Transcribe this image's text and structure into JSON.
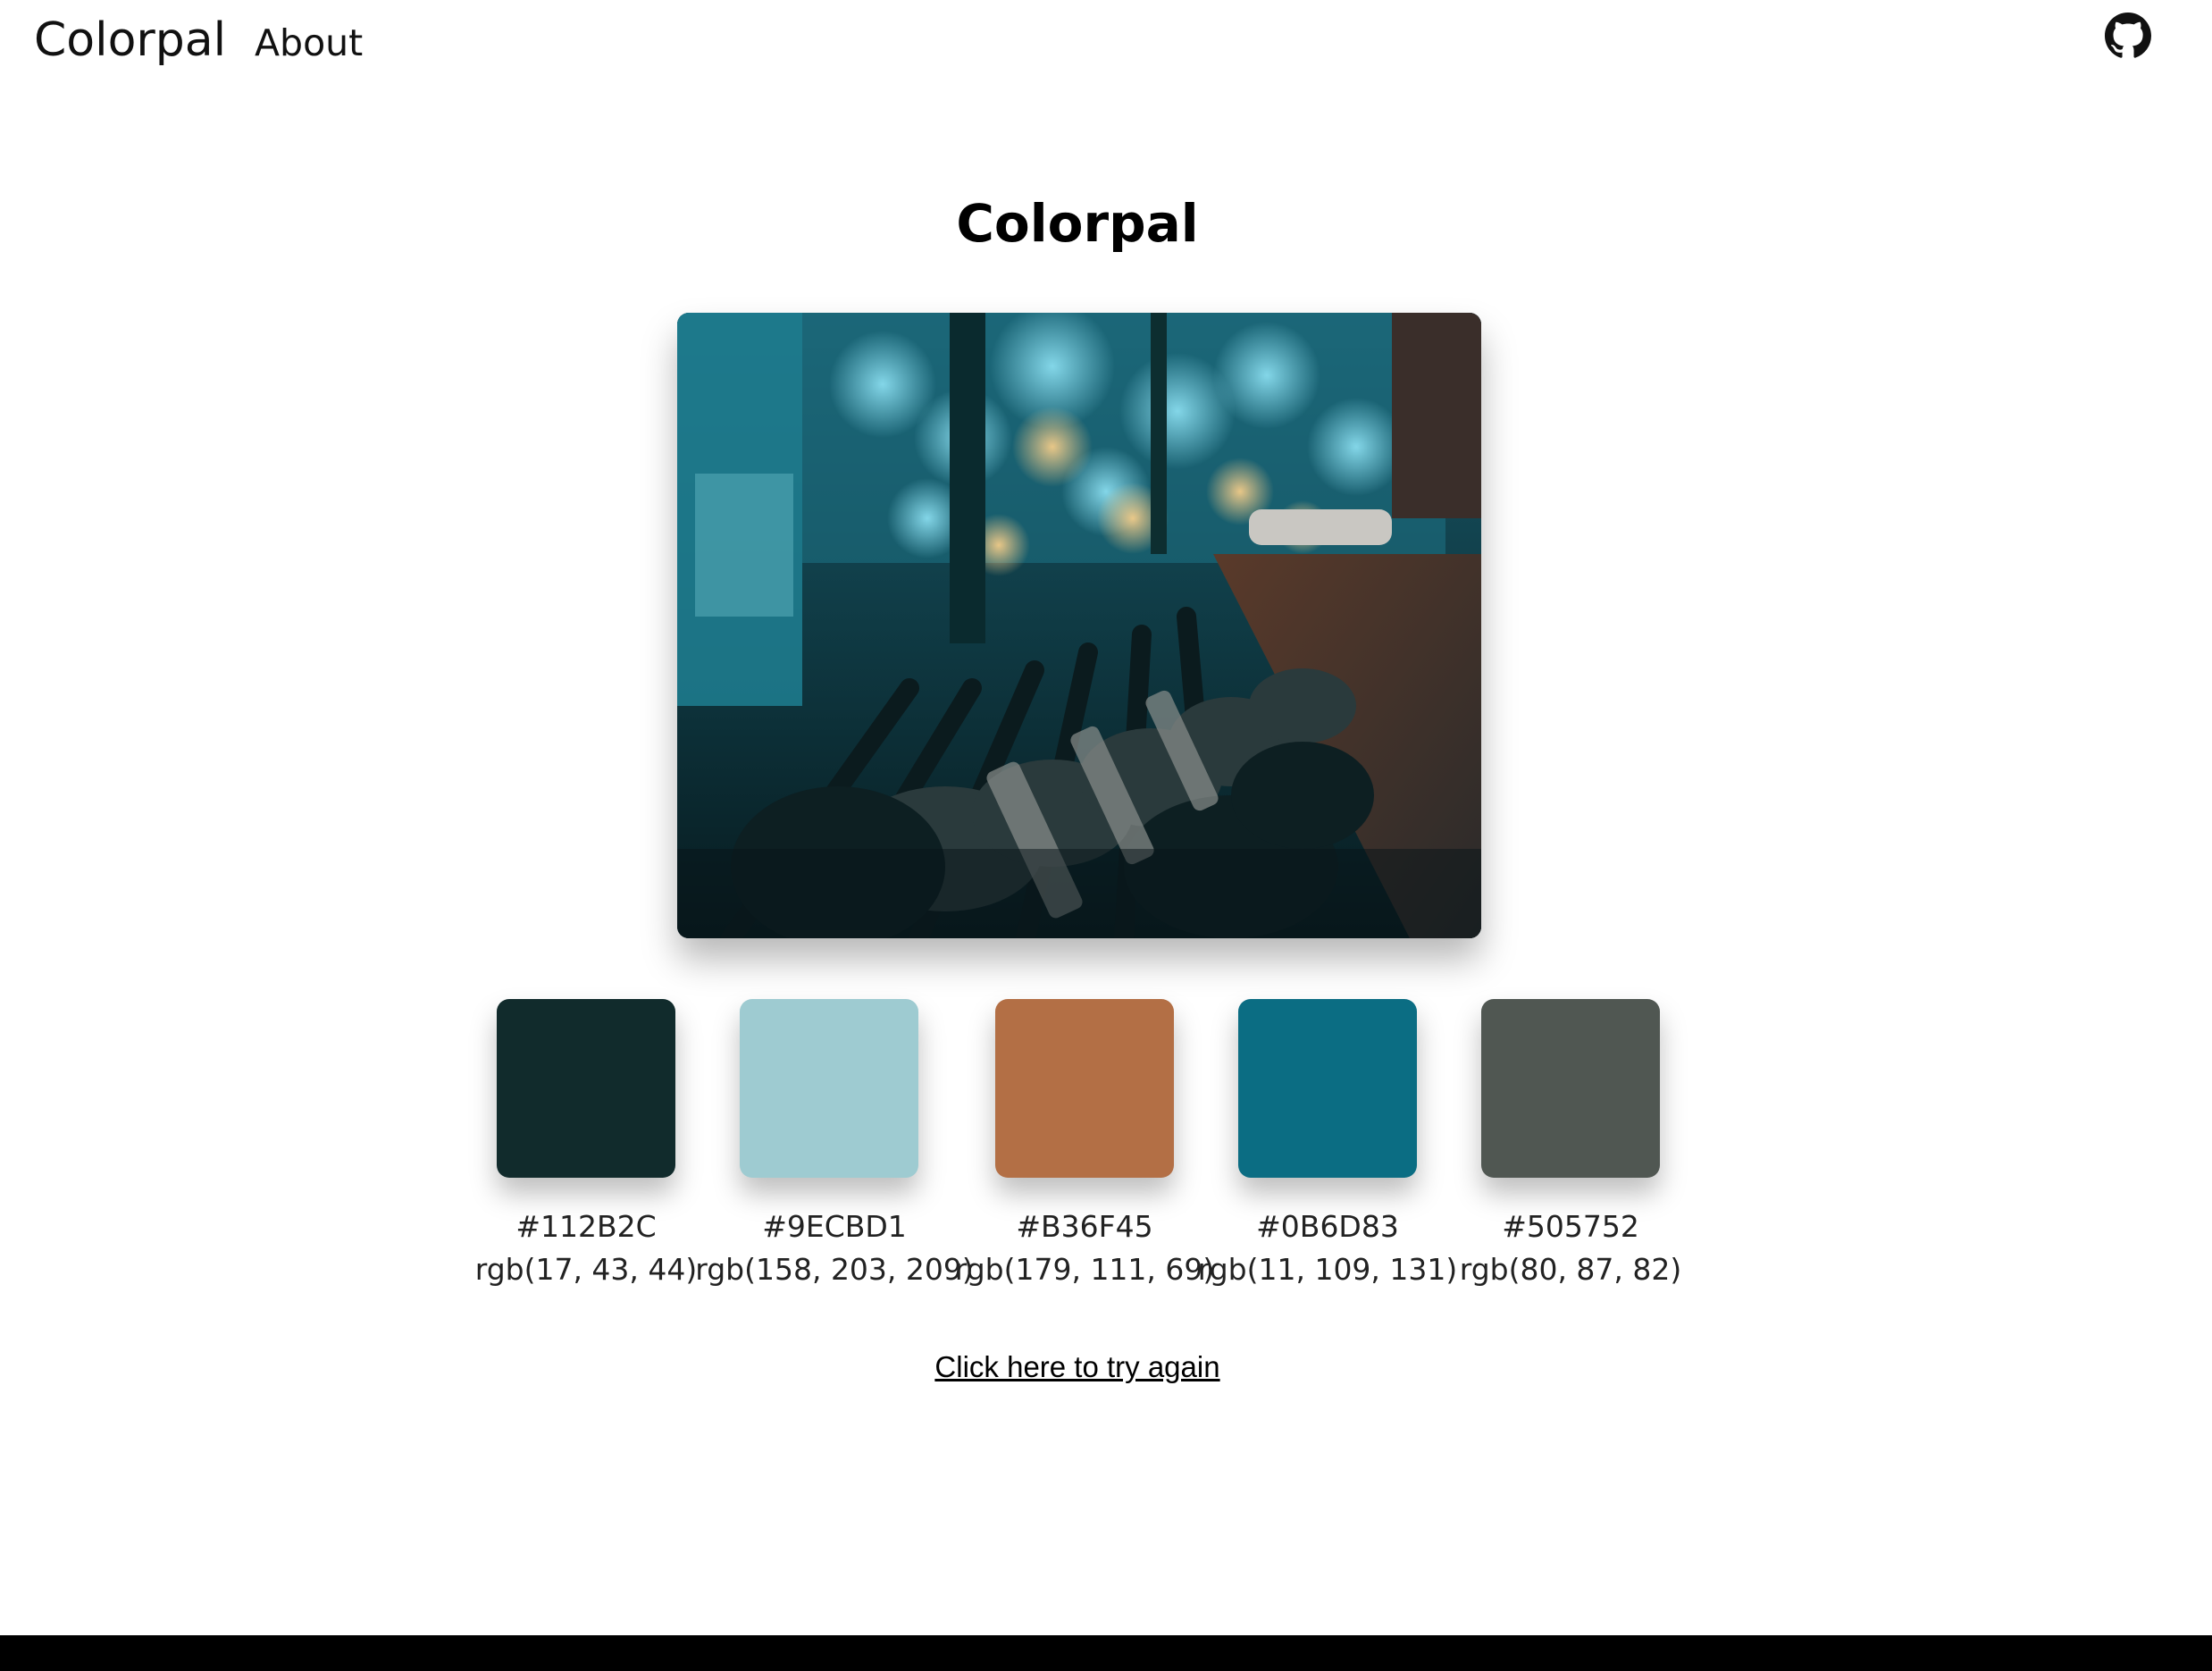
{
  "nav": {
    "brand": "Colorpal",
    "about": "About"
  },
  "icons": {
    "github": "github-icon"
  },
  "main": {
    "title": "Colorpal",
    "try_again": "Click here to try again"
  },
  "palette": [
    {
      "hex": "#112B2C",
      "rgb": "rgb(17, 43, 44)"
    },
    {
      "hex": "#9ECBD1",
      "rgb": "rgb(158, 203, 209)"
    },
    {
      "hex": "#B36F45",
      "rgb": "rgb(179, 111, 69)"
    },
    {
      "hex": "#0B6D83",
      "rgb": "rgb(11, 109, 131)"
    },
    {
      "hex": "#505752",
      "rgb": "rgb(80, 87, 82)"
    }
  ]
}
